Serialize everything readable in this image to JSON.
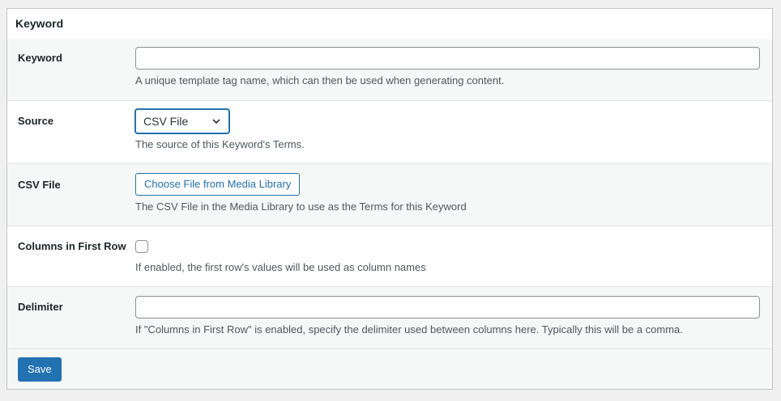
{
  "panel": {
    "title": "Keyword"
  },
  "fields": {
    "keyword": {
      "label": "Keyword",
      "value": "",
      "description": "A unique template tag name, which can then be used when generating content."
    },
    "source": {
      "label": "Source",
      "selected": "CSV File",
      "description": "The source of this Keyword's Terms."
    },
    "csv_file": {
      "label": "CSV File",
      "button_label": "Choose File from Media Library",
      "description": "The CSV File in the Media Library to use as the Terms for this Keyword"
    },
    "columns_first_row": {
      "label": "Columns in First Row",
      "checked": false,
      "description": "If enabled, the first row's values will be used as column names"
    },
    "delimiter": {
      "label": "Delimiter",
      "value": "",
      "description": "If \"Columns in First Row\" is enabled, specify the delimiter used between columns here. Typically this will be a comma."
    }
  },
  "footer": {
    "save_label": "Save"
  },
  "colors": {
    "accent": "#2271b1",
    "page_bg": "#f0f0f1",
    "row_alt_bg": "#f6f7f7"
  },
  "icons": {
    "select_arrow": "chevron-down-icon"
  }
}
